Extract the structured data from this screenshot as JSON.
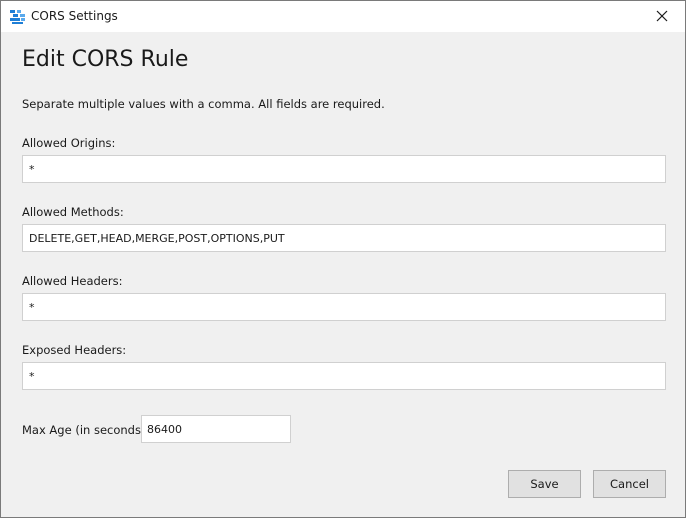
{
  "window": {
    "title": "CORS Settings",
    "app_icon": "storage-explorer-icon",
    "close_icon": "close-icon"
  },
  "dialog": {
    "heading": "Edit CORS Rule",
    "instructions": "Separate multiple values with a comma. All fields are required."
  },
  "fields": {
    "allowed_origins": {
      "label": "Allowed Origins:",
      "value": "*"
    },
    "allowed_methods": {
      "label": "Allowed Methods:",
      "value": "DELETE,GET,HEAD,MERGE,POST,OPTIONS,PUT"
    },
    "allowed_headers": {
      "label": "Allowed Headers:",
      "value": "*"
    },
    "exposed_headers": {
      "label": "Exposed Headers:",
      "value": "*"
    },
    "max_age": {
      "label": "Max Age (in seconds):",
      "value": "86400"
    }
  },
  "buttons": {
    "save": "Save",
    "cancel": "Cancel"
  },
  "colors": {
    "background": "#f0f0f0",
    "titlebar": "#ffffff",
    "button_face": "#e1e1e1",
    "icon_blue": "#1f7fd6"
  }
}
